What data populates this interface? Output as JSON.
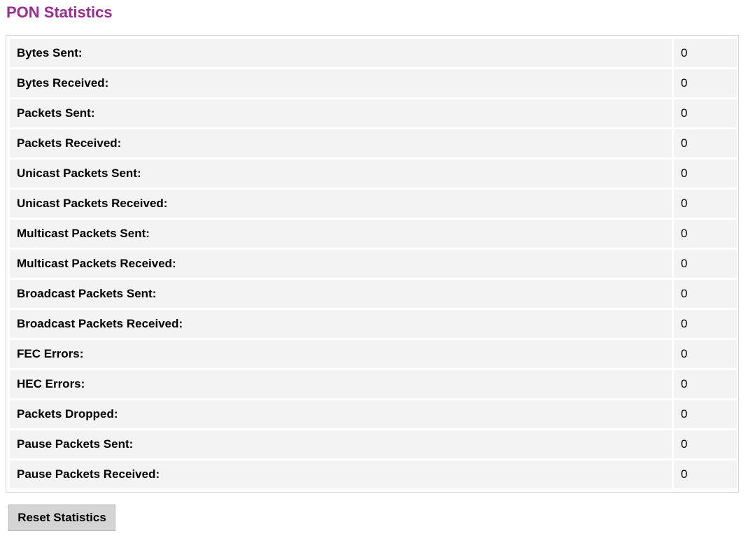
{
  "page": {
    "title": "PON Statistics",
    "title_color": "#9b2d8f"
  },
  "stats": {
    "rows": [
      {
        "label": "Bytes Sent:",
        "value": "0"
      },
      {
        "label": "Bytes Received:",
        "value": "0"
      },
      {
        "label": "Packets Sent:",
        "value": "0"
      },
      {
        "label": "Packets Received:",
        "value": "0"
      },
      {
        "label": "Unicast Packets Sent:",
        "value": "0"
      },
      {
        "label": "Unicast Packets Received:",
        "value": "0"
      },
      {
        "label": "Multicast Packets Sent:",
        "value": "0"
      },
      {
        "label": "Multicast Packets Received:",
        "value": "0"
      },
      {
        "label": "Broadcast Packets Sent:",
        "value": "0"
      },
      {
        "label": "Broadcast Packets Received:",
        "value": "0"
      },
      {
        "label": "FEC Errors:",
        "value": "0"
      },
      {
        "label": "HEC Errors:",
        "value": "0"
      },
      {
        "label": "Packets Dropped:",
        "value": "0"
      },
      {
        "label": "Pause Packets Sent:",
        "value": "0"
      },
      {
        "label": "Pause Packets Received:",
        "value": "0"
      }
    ]
  },
  "actions": {
    "reset_label": "Reset Statistics"
  }
}
